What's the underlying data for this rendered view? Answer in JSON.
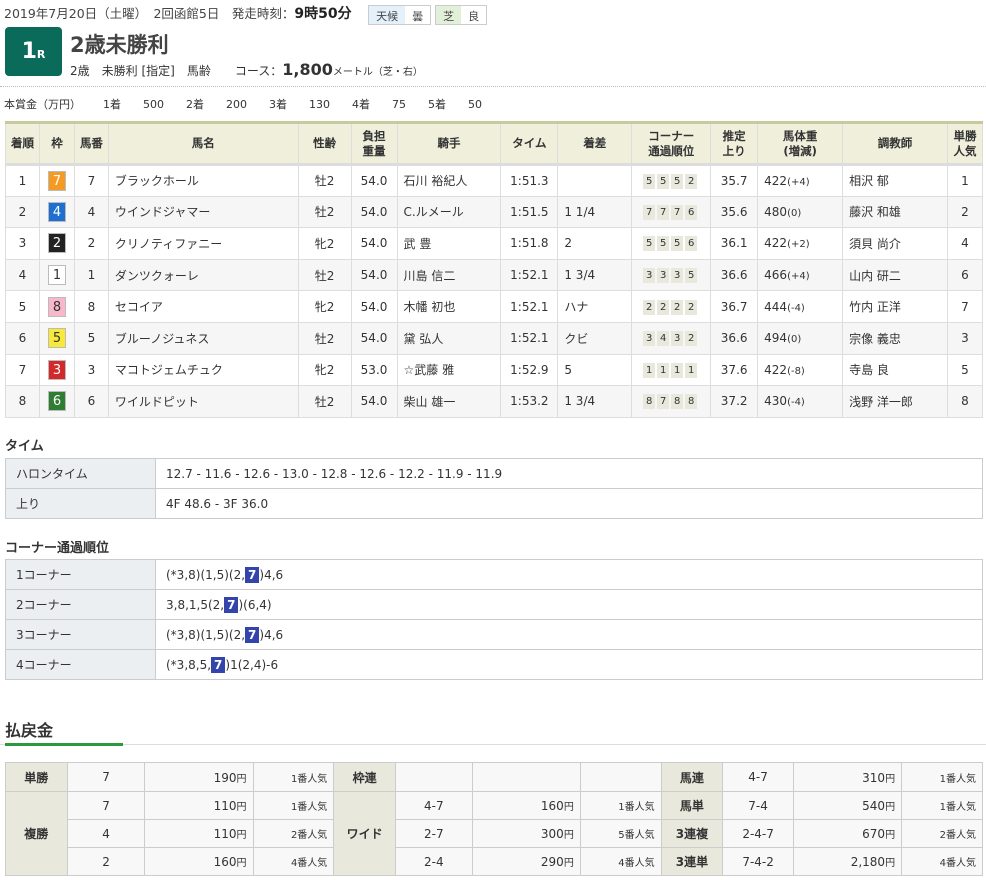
{
  "header": {
    "date": "2019年7月20日（土曜）",
    "meeting": "2回函館5日",
    "post_label": "発走時刻：",
    "post_time": "9時50分",
    "weather_label": "天候",
    "weather": "曇",
    "surface_label": "芝",
    "condition": "良"
  },
  "race": {
    "number": "1",
    "number_suffix": "R",
    "title": "2歳未勝利",
    "conditions": "2歳　未勝利 [指定]　馬齢",
    "course_label": "コース：",
    "distance": "1,800",
    "distance_unit": "メートル（芝・右）"
  },
  "prize": {
    "label": "本賞金（万円）",
    "items": [
      {
        "place": "1着",
        "value": "500"
      },
      {
        "place": "2着",
        "value": "200"
      },
      {
        "place": "3着",
        "value": "130"
      },
      {
        "place": "4着",
        "value": "75"
      },
      {
        "place": "5着",
        "value": "50"
      }
    ]
  },
  "results": {
    "headers": [
      "着順",
      "枠",
      "馬番",
      "馬名",
      "性齢",
      "負担\n重量",
      "騎手",
      "タイム",
      "着差",
      "コーナー\n通過順位",
      "推定\n上り",
      "馬体重\n(増減)",
      "調教師",
      "単勝\n人気"
    ],
    "waku_colors": {
      "1": "#ffffff",
      "2": "#222222",
      "3": "#d22a2a",
      "4": "#1e6fcf",
      "5": "#f7e83a",
      "6": "#2e7d32",
      "7": "#f59a23",
      "8": "#f7b8cc"
    },
    "rows": [
      {
        "pos": "1",
        "waku": "7",
        "num": "7",
        "name": "ブラックホール",
        "sex": "牡2",
        "wt": "54.0",
        "jockey": "石川 裕紀人",
        "time": "1:51.3",
        "margin": "",
        "corners": [
          "5",
          "5",
          "5",
          "2"
        ],
        "last3f": "35.7",
        "body": "422",
        "diff": "(+4)",
        "trainer": "相沢 郁",
        "pop": "1"
      },
      {
        "pos": "2",
        "waku": "4",
        "num": "4",
        "name": "ウインドジャマー",
        "sex": "牡2",
        "wt": "54.0",
        "jockey": "C.ルメール",
        "time": "1:51.5",
        "margin": "1 1/4",
        "corners": [
          "7",
          "7",
          "7",
          "6"
        ],
        "last3f": "35.6",
        "body": "480",
        "diff": "(0)",
        "trainer": "藤沢 和雄",
        "pop": "2"
      },
      {
        "pos": "3",
        "waku": "2",
        "num": "2",
        "name": "クリノティファニー",
        "sex": "牝2",
        "wt": "54.0",
        "jockey": "武 豊",
        "time": "1:51.8",
        "margin": "2",
        "corners": [
          "5",
          "5",
          "5",
          "6"
        ],
        "last3f": "36.1",
        "body": "422",
        "diff": "(+2)",
        "trainer": "須貝 尚介",
        "pop": "4"
      },
      {
        "pos": "4",
        "waku": "1",
        "num": "1",
        "name": "ダンツクォーレ",
        "sex": "牡2",
        "wt": "54.0",
        "jockey": "川島 信二",
        "time": "1:52.1",
        "margin": "1 3/4",
        "corners": [
          "3",
          "3",
          "3",
          "5"
        ],
        "last3f": "36.6",
        "body": "466",
        "diff": "(+4)",
        "trainer": "山内 研二",
        "pop": "6"
      },
      {
        "pos": "5",
        "waku": "8",
        "num": "8",
        "name": "セコイア",
        "sex": "牝2",
        "wt": "54.0",
        "jockey": "木幡 初也",
        "time": "1:52.1",
        "margin": "ハナ",
        "corners": [
          "2",
          "2",
          "2",
          "2"
        ],
        "last3f": "36.7",
        "body": "444",
        "diff": "(-4)",
        "trainer": "竹内 正洋",
        "pop": "7"
      },
      {
        "pos": "6",
        "waku": "5",
        "num": "5",
        "name": "ブルーノジュネス",
        "sex": "牡2",
        "wt": "54.0",
        "jockey": "黛 弘人",
        "time": "1:52.1",
        "margin": "クビ",
        "corners": [
          "3",
          "4",
          "3",
          "2"
        ],
        "last3f": "36.6",
        "body": "494",
        "diff": "(0)",
        "trainer": "宗像 義忠",
        "pop": "3"
      },
      {
        "pos": "7",
        "waku": "3",
        "num": "3",
        "name": "マコトジェムチュク",
        "sex": "牝2",
        "wt": "53.0",
        "jockey": "☆武藤 雅",
        "time": "1:52.9",
        "margin": "5",
        "corners": [
          "1",
          "1",
          "1",
          "1"
        ],
        "last3f": "37.6",
        "body": "422",
        "diff": "(-8)",
        "trainer": "寺島 良",
        "pop": "5"
      },
      {
        "pos": "8",
        "waku": "6",
        "num": "6",
        "name": "ワイルドピット",
        "sex": "牡2",
        "wt": "54.0",
        "jockey": "柴山 雄一",
        "time": "1:53.2",
        "margin": "1 3/4",
        "corners": [
          "8",
          "7",
          "8",
          "8"
        ],
        "last3f": "37.2",
        "body": "430",
        "diff": "(-4)",
        "trainer": "浅野 洋一郎",
        "pop": "8"
      }
    ]
  },
  "time_section": {
    "title": "タイム",
    "rows": [
      {
        "label": "ハロンタイム",
        "value": "12.7 - 11.6 - 12.6 - 13.0 - 12.8 - 12.6 - 12.2 - 11.9 - 11.9"
      },
      {
        "label": "上り",
        "value": "4F 48.6 - 3F 36.0"
      }
    ]
  },
  "corner_section": {
    "title": "コーナー通過順位",
    "rows": [
      {
        "label": "1コーナー",
        "before": "(*3,8)(1,5)(2,",
        "winner": "7",
        "after": ")4,6"
      },
      {
        "label": "2コーナー",
        "before": "3,8,1,5(2,",
        "winner": "7",
        "after": ")(6,4)"
      },
      {
        "label": "3コーナー",
        "before": "(*3,8)(1,5)(2,",
        "winner": "7",
        "after": ")4,6"
      },
      {
        "label": "4コーナー",
        "before": "(*3,8,5,",
        "winner": "7",
        "after": ")1(2,4)-6"
      }
    ]
  },
  "payout": {
    "title": "払戻金",
    "yen": "円",
    "tansho": {
      "label": "単勝",
      "rows": [
        {
          "combo": "7",
          "amount": "190",
          "pop": "1番人気"
        }
      ]
    },
    "fukusho": {
      "label": "複勝",
      "rows": [
        {
          "combo": "7",
          "amount": "110",
          "pop": "1番人気"
        },
        {
          "combo": "4",
          "amount": "110",
          "pop": "2番人気"
        },
        {
          "combo": "2",
          "amount": "160",
          "pop": "4番人気"
        }
      ]
    },
    "wakuren": {
      "label": "枠連"
    },
    "wide": {
      "label": "ワイド",
      "rows": [
        {
          "combo": "4-7",
          "amount": "160",
          "pop": "1番人気"
        },
        {
          "combo": "2-7",
          "amount": "300",
          "pop": "5番人気"
        },
        {
          "combo": "2-4",
          "amount": "290",
          "pop": "4番人気"
        }
      ]
    },
    "right": [
      {
        "label": "馬連",
        "combo": "4-7",
        "amount": "310",
        "pop": "1番人気"
      },
      {
        "label": "馬単",
        "combo": "7-4",
        "amount": "540",
        "pop": "1番人気"
      },
      {
        "label": "3連複",
        "combo": "2-4-7",
        "amount": "670",
        "pop": "2番人気"
      },
      {
        "label": "3連単",
        "combo": "7-4-2",
        "amount": "2,180",
        "pop": "4番人気"
      }
    ]
  }
}
